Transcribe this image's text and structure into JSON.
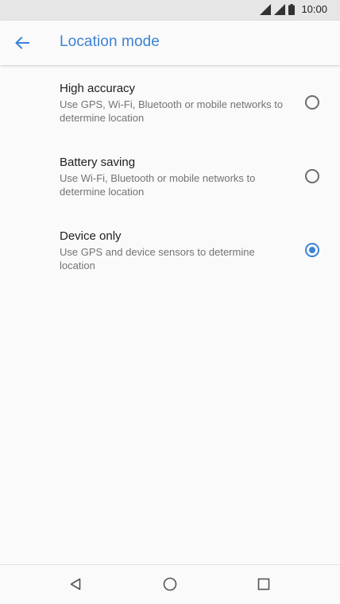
{
  "status_bar": {
    "time": "10:00",
    "icons": [
      "wifi-signal-icon",
      "cell-signal-icon",
      "battery-icon"
    ]
  },
  "app_bar": {
    "back_icon": "arrow-back-icon",
    "title": "Location mode"
  },
  "options": [
    {
      "title": "High accuracy",
      "summary": "Use GPS, Wi-Fi, Bluetooth or mobile networks to determine location",
      "selected": false
    },
    {
      "title": "Battery saving",
      "summary": "Use Wi-Fi, Bluetooth or mobile networks to determine location",
      "selected": false
    },
    {
      "title": "Device only",
      "summary": "Use GPS and device sensors to determine location",
      "selected": true
    }
  ],
  "nav_bar": {
    "icons": [
      "nav-back-icon",
      "nav-home-icon",
      "nav-recents-icon"
    ]
  },
  "colors": {
    "accent": "#3b82d6",
    "background": "#fafafa",
    "status_bar": "#e6e6e6"
  }
}
